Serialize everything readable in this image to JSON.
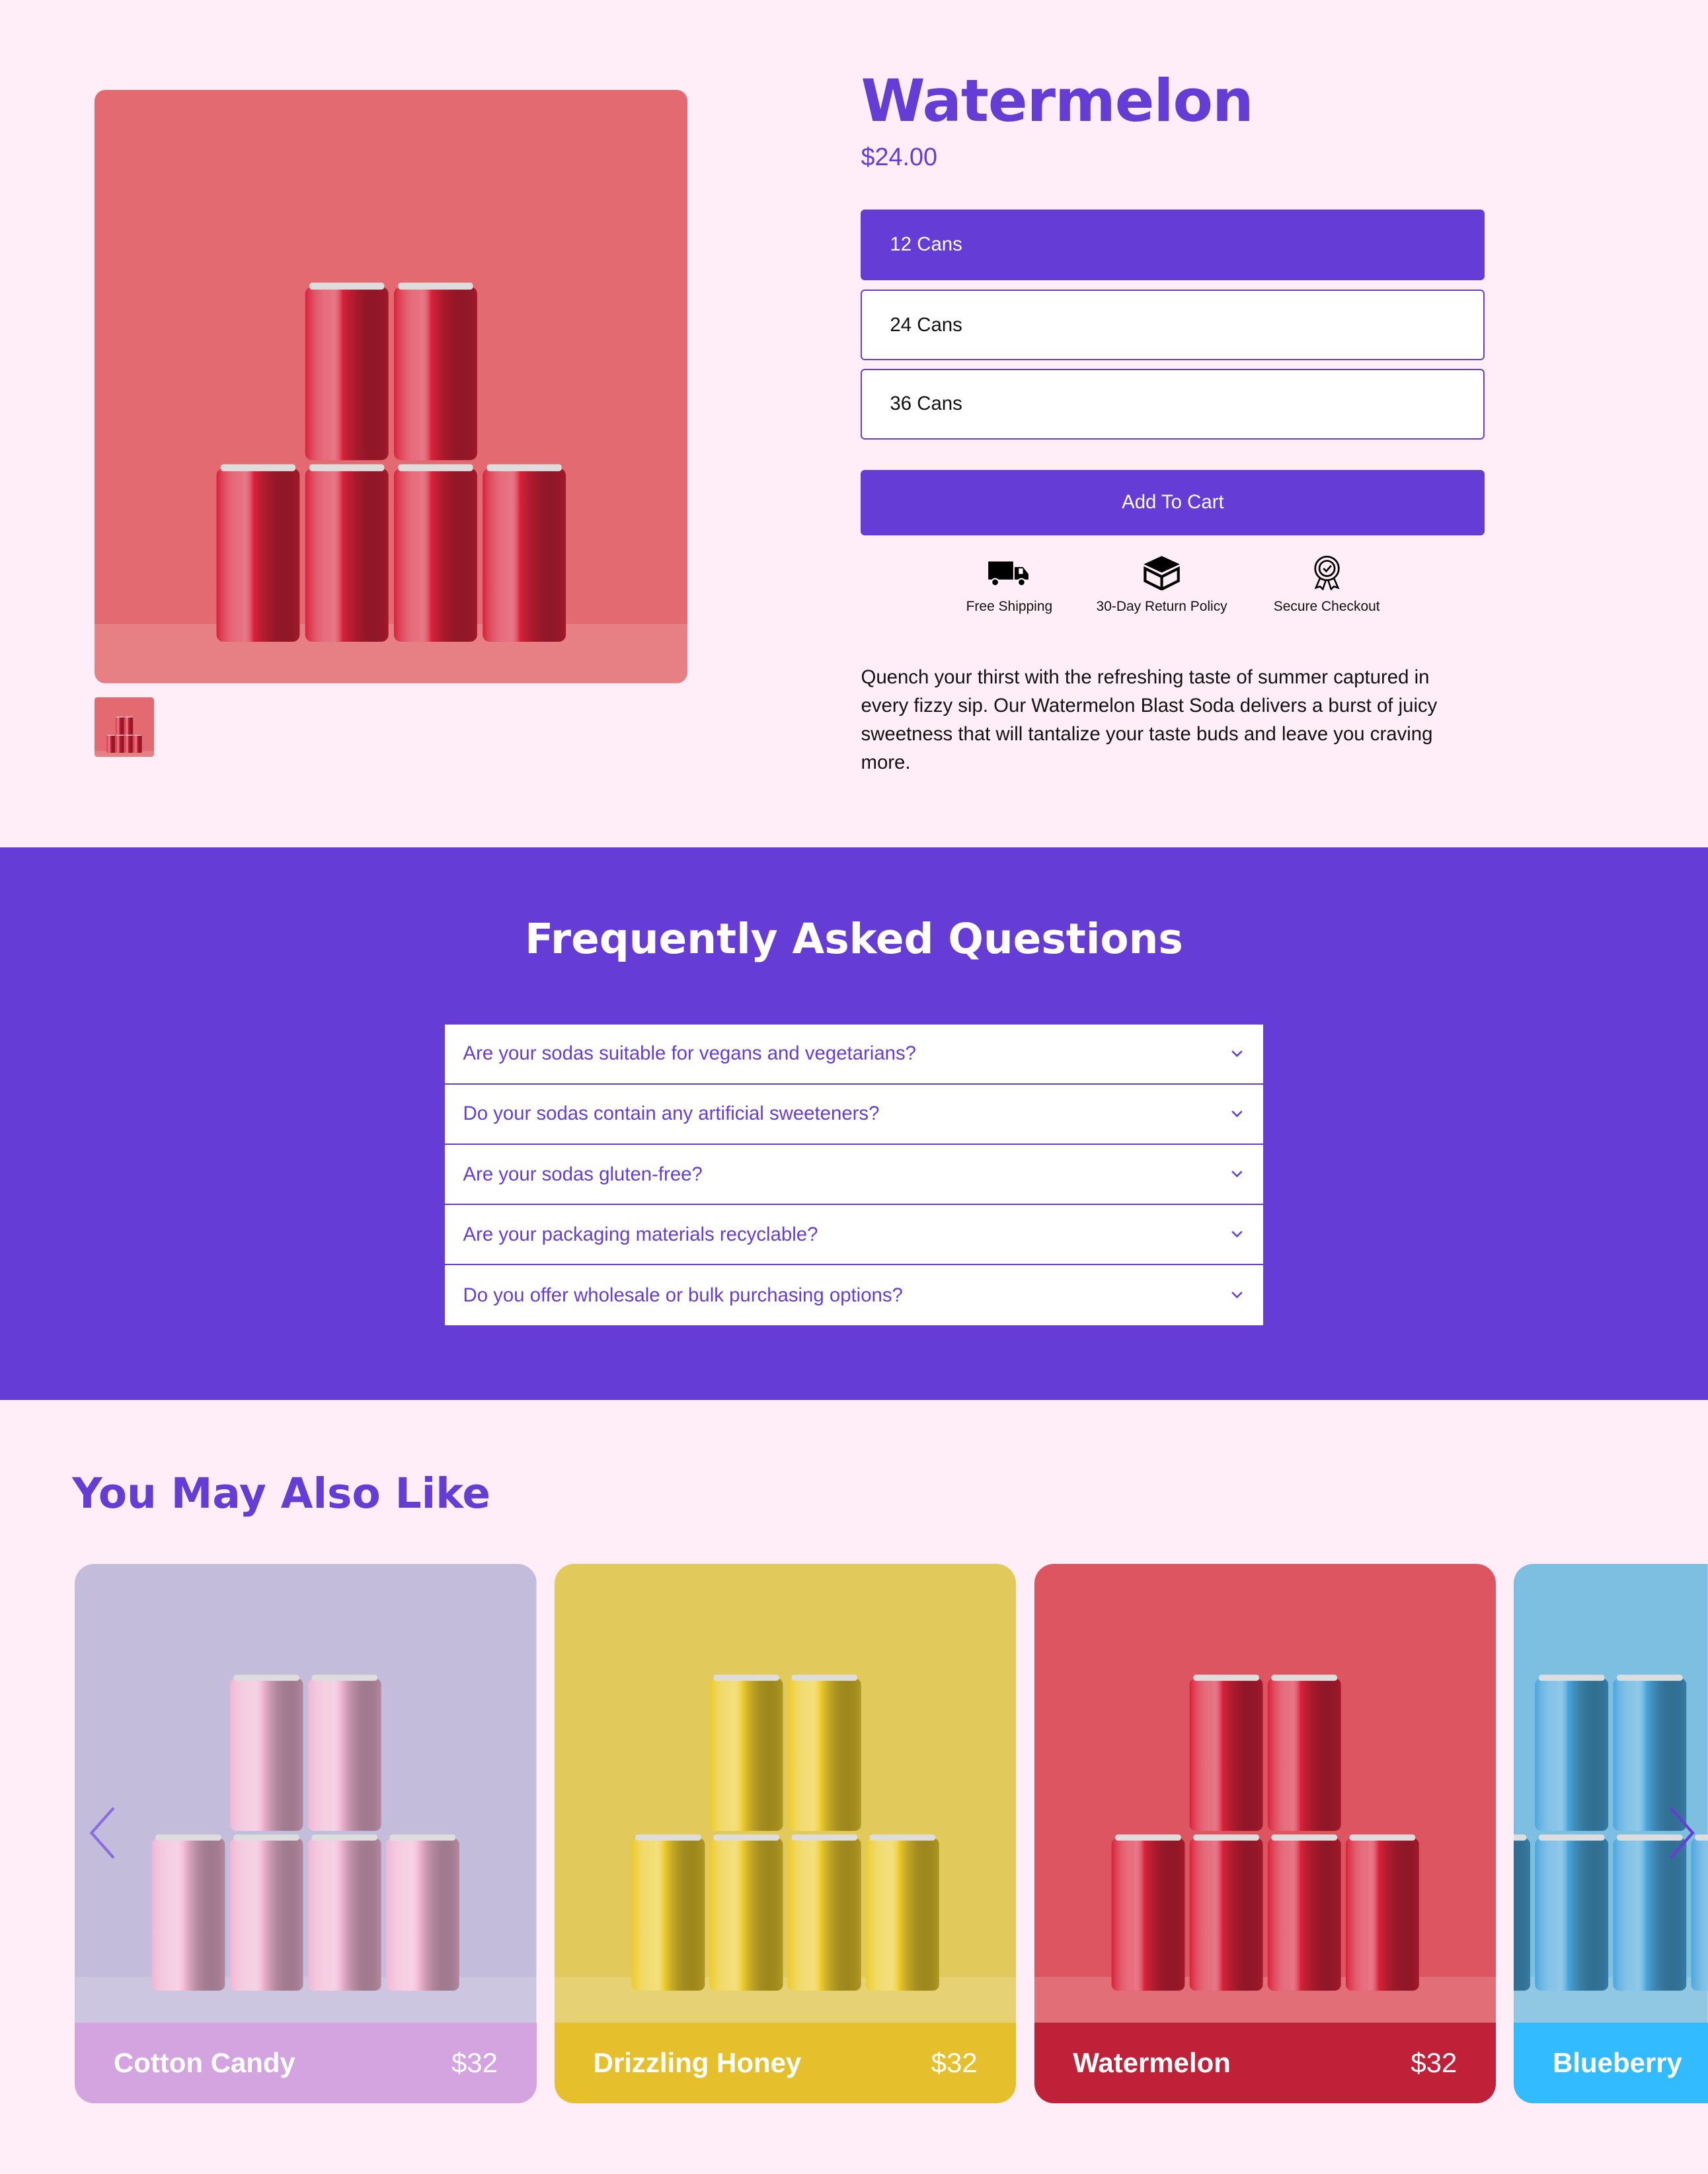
{
  "product": {
    "title": "Watermelon",
    "price": "$24.00",
    "options": [
      {
        "label": "12 Cans",
        "selected": true
      },
      {
        "label": "24 Cans",
        "selected": false
      },
      {
        "label": "36 Cans",
        "selected": false
      }
    ],
    "add_to_cart": "Add To Cart",
    "features": [
      {
        "icon": "truck-icon",
        "label": "Free Shipping"
      },
      {
        "icon": "box-icon",
        "label": "30-Day Return Policy"
      },
      {
        "icon": "badge-check-icon",
        "label": "Secure Checkout"
      }
    ],
    "description": "Quench your thirst with the refreshing taste of summer captured in every fizzy sip. Our Watermelon Blast Soda delivers a burst of juicy sweetness that will tantalize your taste buds and leave you craving more."
  },
  "faq": {
    "title": "Frequently Asked Questions",
    "items": [
      "Are your sodas suitable for vegans and vegetarians?",
      "Do your sodas contain any artificial sweeteners?",
      "Are your sodas gluten-free?",
      "Are your packaging materials recyclable?",
      "Do you offer wholesale or bulk purchasing options?"
    ]
  },
  "related": {
    "title": "You May Also Like",
    "items": [
      {
        "name": "Cotton Candy",
        "price": "$32",
        "bg": "#c4bcdb",
        "can": "#f0b6d4",
        "footer": "#d4a4e0"
      },
      {
        "name": "Drizzling Honey",
        "price": "$32",
        "bg": "#e2c95c",
        "can": "#eccb2c",
        "footer": "#e6c02c"
      },
      {
        "name": "Watermelon",
        "price": "$32",
        "bg": "#dd5561",
        "can": "#d8223a",
        "footer": "#c12138"
      },
      {
        "name": "Blueberry",
        "price": "",
        "bg": "#7dbfe0",
        "can": "#4aa6dc",
        "footer": "#33bbff"
      }
    ]
  },
  "colors": {
    "accent": "#663cd6",
    "background": "#ffeef8"
  }
}
